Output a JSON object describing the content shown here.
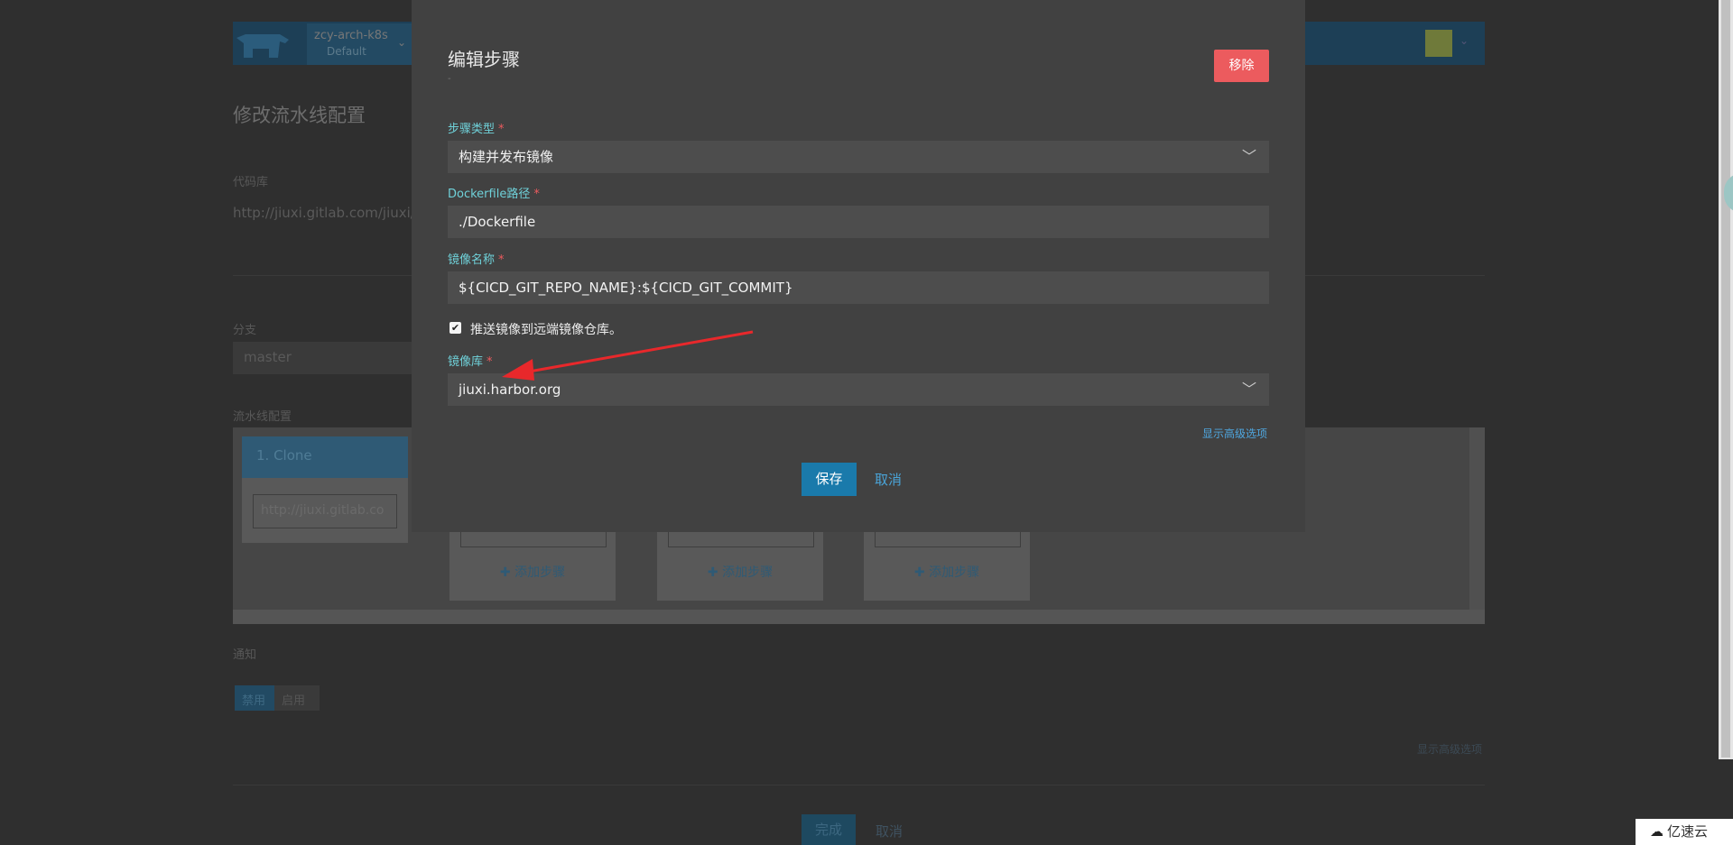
{
  "background": {
    "cluster_name": "zcy-arch-k8s",
    "project_name": "Default",
    "page_title": "修改流水线配置",
    "repo_label": "代码库",
    "repo_value": "http://jiuxi.gitlab.com/jiuxi/c",
    "branch_label": "分支",
    "branch_value": "master",
    "pipeline_label": "流水线配置",
    "clone_stage": "1. Clone",
    "clone_url": "http://jiuxi.gitlab.co",
    "add_step": "添加步骤",
    "notify_label": "通知",
    "notify_off": "禁用",
    "notify_on": "启用",
    "advanced": "显示高级选项",
    "done": "完成",
    "cancel": "取消"
  },
  "modal": {
    "title": "编辑步骤",
    "subtitle": "-",
    "remove": "移除",
    "step_type_label": "步骤类型",
    "step_type_value": "构建并发布镜像",
    "dockerfile_label": "Dockerfile路径",
    "dockerfile_value": "./Dockerfile",
    "image_name_label": "镜像名称",
    "image_name_value": "${CICD_GIT_REPO_NAME}:${CICD_GIT_COMMIT}",
    "push_checkbox_label": "推送镜像到远端镜像仓库。",
    "push_checked": true,
    "registry_label": "镜像库",
    "registry_value": "jiuxi.harbor.org",
    "advanced_link": "显示高级选项",
    "save": "保存",
    "cancel": "取消"
  },
  "icons": {
    "dropdown": "chevron-down-icon",
    "check": "checkmark-icon",
    "add": "plus-icon",
    "annotation": "red-arrow",
    "watermark_icon": "cloud-icon"
  },
  "watermark": "亿速云",
  "colors": {
    "accent": "#1a7aab",
    "danger": "#ec5b5e",
    "label": "#6fd1d9",
    "arrow": "#e8282b"
  }
}
